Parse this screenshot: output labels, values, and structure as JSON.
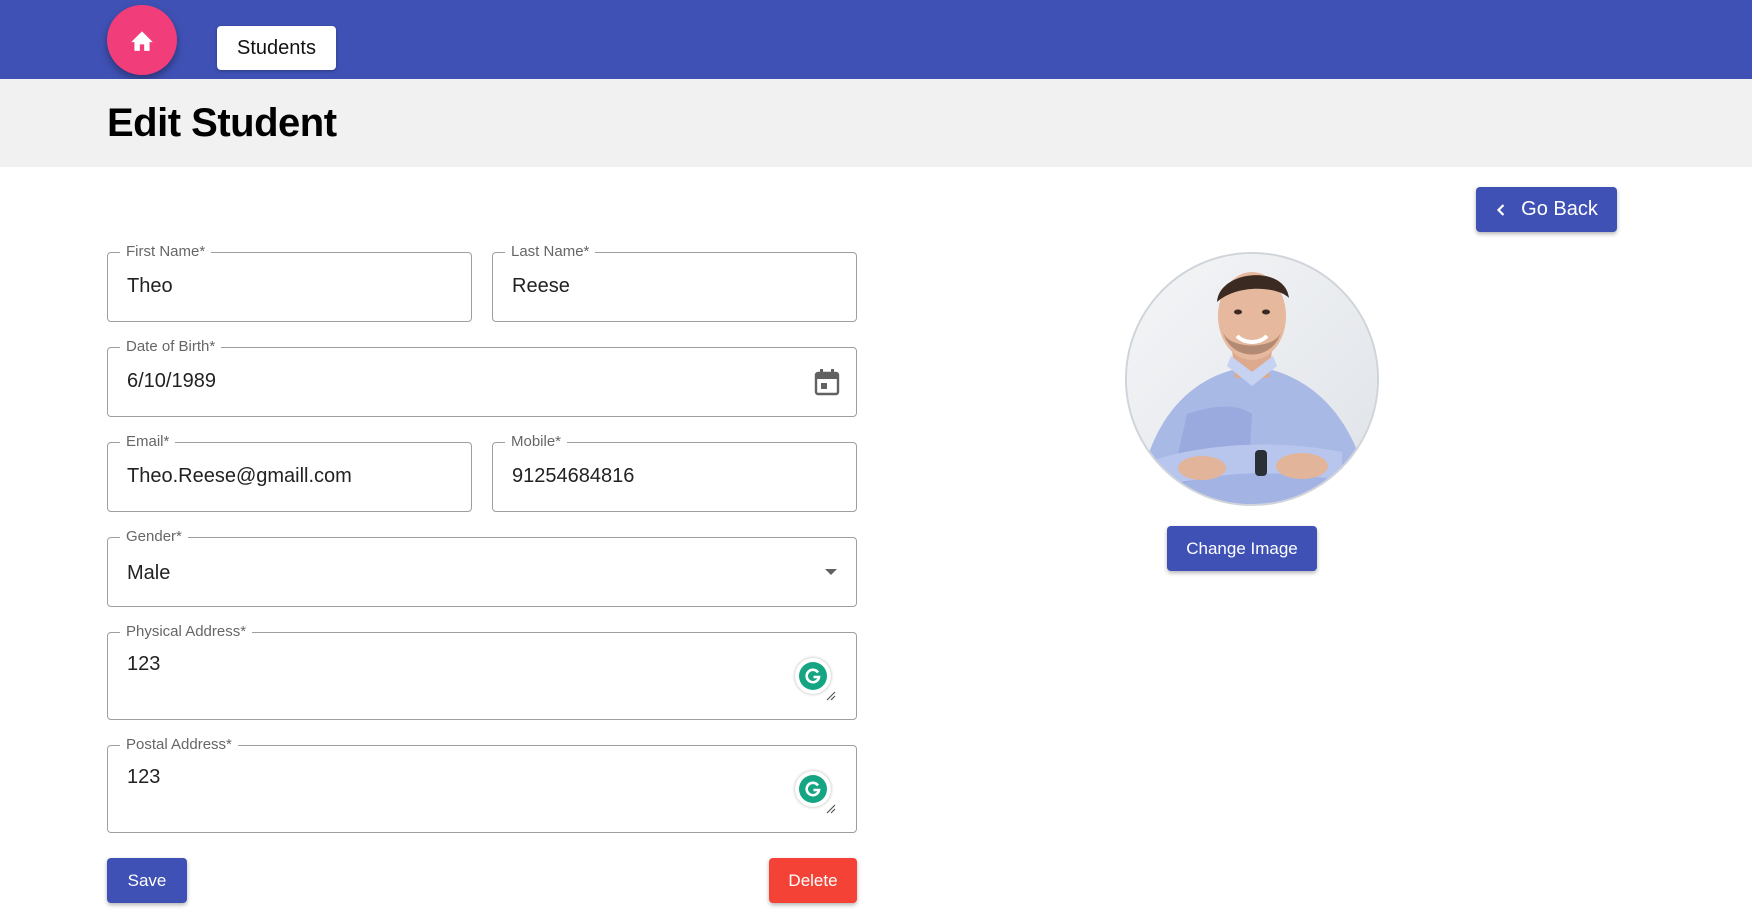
{
  "header": {
    "home_icon": "home-icon",
    "nav_label": "Students",
    "colors": {
      "appbar": "#3f51b5",
      "fab": "#f13d7a"
    }
  },
  "page": {
    "title": "Edit Student"
  },
  "actions": {
    "go_back": "Go Back",
    "go_back_icon": "chevron-left-icon"
  },
  "form": {
    "first_name": {
      "label": "First Name*",
      "value": "Theo"
    },
    "last_name": {
      "label": "Last Name*",
      "value": "Reese"
    },
    "dob": {
      "label": "Date of Birth*",
      "value": "6/10/1989",
      "icon": "calendar-icon"
    },
    "email": {
      "label": "Email*",
      "value": "Theo.Reese@gmaill.com"
    },
    "mobile": {
      "label": "Mobile*",
      "value": "91254684816"
    },
    "gender": {
      "label": "Gender*",
      "value": "Male",
      "icon": "dropdown-arrow-icon"
    },
    "physical_address": {
      "label": "Physical Address*",
      "value": "123"
    },
    "postal_address": {
      "label": "Postal Address*",
      "value": "123"
    },
    "save_label": "Save",
    "delete_label": "Delete",
    "colors": {
      "primary": "#3f51b5",
      "danger": "#f44336"
    }
  },
  "profile": {
    "change_image_label": "Change Image"
  }
}
